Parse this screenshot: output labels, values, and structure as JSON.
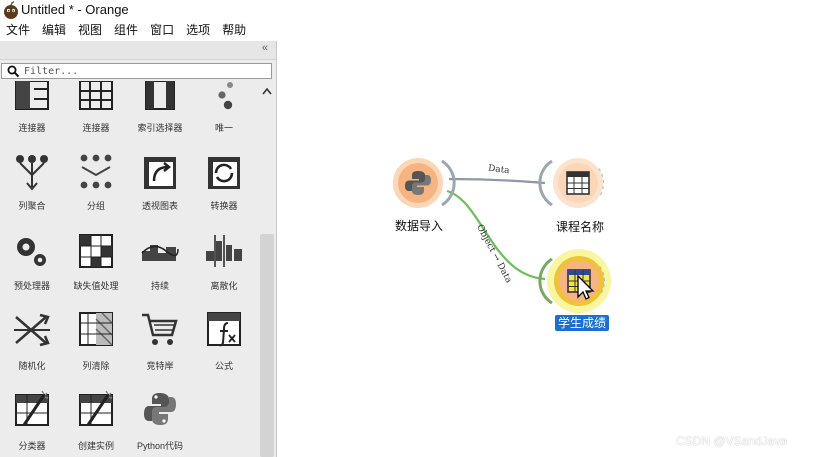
{
  "window": {
    "title": "Untitled * - Orange"
  },
  "menu": [
    "文件",
    "编辑",
    "视图",
    "组件",
    "窗口",
    "选项",
    "帮助"
  ],
  "panel": {
    "collapse_glyph": "«",
    "filter_placeholder": "Filter..."
  },
  "widgets": [
    {
      "label": "连接器",
      "icon": "merge-icon"
    },
    {
      "label": "连接器",
      "icon": "concat-icon"
    },
    {
      "label": "索引选择器",
      "icon": "select-rows-icon"
    },
    {
      "label": "唯一",
      "icon": "unique-icon"
    },
    {
      "label": "列聚合",
      "icon": "aggregate-columns-icon"
    },
    {
      "label": "分组",
      "icon": "group-by-icon"
    },
    {
      "label": "透视图表",
      "icon": "pivot-icon"
    },
    {
      "label": "转换器",
      "icon": "transpose-icon"
    },
    {
      "label": "预处理器",
      "icon": "preprocess-icon"
    },
    {
      "label": "缺失值处理",
      "icon": "impute-icon"
    },
    {
      "label": "持续",
      "icon": "continuize-icon"
    },
    {
      "label": "离散化",
      "icon": "discretize-icon"
    },
    {
      "label": "随机化",
      "icon": "randomize-icon"
    },
    {
      "label": "列清除",
      "icon": "purge-domain-icon"
    },
    {
      "label": "竞特岸",
      "icon": "cart-icon"
    },
    {
      "label": "公式",
      "icon": "formula-icon"
    },
    {
      "label": "分类器",
      "icon": "create-class-icon"
    },
    {
      "label": "创建实例",
      "icon": "create-instance-icon"
    },
    {
      "label": "Python代码",
      "icon": "python-icon"
    }
  ],
  "canvas": {
    "nodes": [
      {
        "label": "数据导入",
        "icon": "python-icon",
        "selected": false
      },
      {
        "label": "课程名称",
        "icon": "table-icon",
        "selected": false
      },
      {
        "label": "学生成绩",
        "icon": "table-icon",
        "selected": true
      }
    ],
    "links": [
      {
        "from": "数据导入",
        "to": "课程名称",
        "label": "Data"
      },
      {
        "from": "数据导入",
        "to": "学生成绩",
        "label": "Object → Data"
      }
    ]
  },
  "watermark": "CSDN @VSandJava",
  "colors": {
    "selection": "#1a6fd0",
    "node_fill": "#f6b482",
    "link_green": "#6cbf5a",
    "link_gray": "#8a9aa8"
  }
}
